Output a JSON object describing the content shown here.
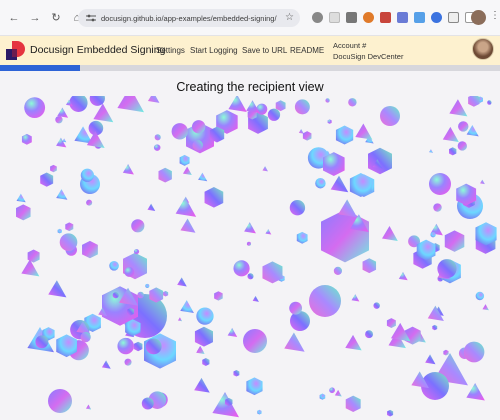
{
  "browser": {
    "url": "docusign.github.io/app-examples/embedded-signing/",
    "nav_icons": [
      "back-icon",
      "forward-icon",
      "reload-icon",
      "home-icon"
    ]
  },
  "app": {
    "title": "Docusign Embedded Signing",
    "menu": [
      "Settings",
      "Start Logging",
      "Save to URL",
      "README"
    ],
    "account_label": "Account #",
    "account_name": "DocuSign DevCenter"
  },
  "progress": {
    "fraction": 0.16,
    "color": "#2d63d6"
  },
  "main": {
    "title": "Creating the recipient view"
  },
  "colors": {
    "header_bg": "#fdf1cf",
    "logo_red": "#e5343f",
    "logo_dark": "#2b1a66"
  }
}
